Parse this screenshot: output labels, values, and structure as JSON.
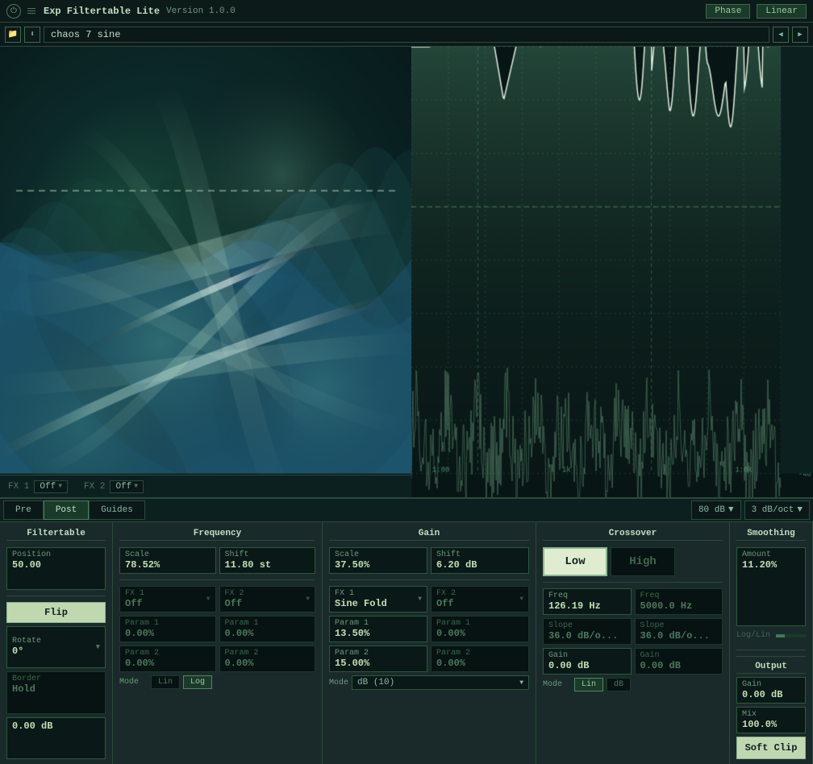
{
  "titlebar": {
    "app_name": "Exp Filtertable Lite",
    "version": "Version 1.0.0",
    "phase_btn": "Phase",
    "linear_btn": "Linear"
  },
  "preset": {
    "name": "chaos 7 sine",
    "prev_arrow": "◀",
    "next_arrow": "▶",
    "save_icon": "💾",
    "folder_icon": "📁"
  },
  "fx1_label": "FX 1",
  "fx1_value": "Off",
  "fx2_label": "FX 2",
  "fx2_value": "Off",
  "spectrum_controls": {
    "pre_btn": "Pre",
    "post_btn": "Post",
    "guides_btn": "Guides",
    "db_range": "80 dB",
    "slope": "3 dB/oct"
  },
  "filtertable": {
    "title": "Filtertable",
    "position_label": "Position",
    "position_value": "50.00",
    "flip_btn": "Flip",
    "rotate_label": "Rotate",
    "rotate_value": "0°",
    "border_label": "Border",
    "border_value": "Hold",
    "db_value": "0.00 dB"
  },
  "frequency": {
    "title": "Frequency",
    "scale_label": "Scale",
    "scale_value": "78.52%",
    "shift_label": "Shift",
    "shift_value": "11.80 st",
    "fx1_label": "FX 1",
    "fx1_value": "Off",
    "fx2_label": "FX 2",
    "fx2_value": "Off",
    "param1_a_label": "Param 1",
    "param1_a_value": "0.00%",
    "param1_b_label": "Param 1",
    "param1_b_value": "0.00%",
    "param2_a_label": "Param 2",
    "param2_a_value": "0.00%",
    "param2_b_label": "Param 2",
    "param2_b_value": "0.00%",
    "mode_label": "Mode",
    "lin_btn": "Lin",
    "log_btn": "Log"
  },
  "gain": {
    "title": "Gain",
    "scale_label": "Scale",
    "scale_value": "37.50%",
    "shift_label": "Shift",
    "shift_value": "6.20 dB",
    "fx1_label": "FX 1",
    "fx1_value": "Sine Fold",
    "fx2_label": "FX 2",
    "fx2_value": "Off",
    "param1_label": "Param 1",
    "param1_value": "13.50%",
    "param1_b_label": "Param 1",
    "param1_b_value": "0.00%",
    "param2_label": "Param 2",
    "param2_value": "15.00%",
    "param2_b_label": "Param 2",
    "param2_b_value": "0.00%",
    "mode_label": "Mode",
    "mode_value": "dB (10)"
  },
  "crossover": {
    "title": "Crossover",
    "low_btn": "Low",
    "high_btn": "High",
    "freq_a_label": "Freq",
    "freq_a_value": "126.19 Hz",
    "freq_b_label": "Freq",
    "freq_b_value": "5000.0 Hz",
    "slope_a_label": "Slope",
    "slope_a_value": "36.0 dB/o...",
    "slope_b_label": "Slope",
    "slope_b_value": "36.0 dB/o...",
    "gain_a_label": "Gain",
    "gain_a_value": "0.00 dB",
    "gain_b_label": "Gain",
    "gain_b_value": "0.00 dB",
    "mode_label": "Mode",
    "lin_btn": "Lin",
    "db_btn": "dB"
  },
  "smoothing": {
    "title": "Smoothing",
    "amount_label": "Amount",
    "amount_value": "11.20%",
    "loglin_label": "Log/Lin"
  },
  "output": {
    "title": "Output",
    "gain_label": "Gain",
    "gain_value": "0.00 dB",
    "mix_label": "Mix",
    "mix_value": "100.0%",
    "soft_clip_btn": "Soft Clip"
  }
}
